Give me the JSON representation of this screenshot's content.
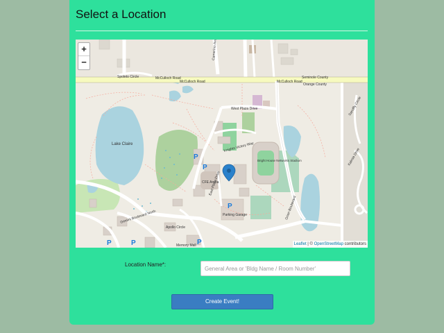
{
  "page": {
    "title": "Select a Location",
    "accent_color": "#2ee09c",
    "background_color": "#9dbba3"
  },
  "map": {
    "zoom_in_label": "+",
    "zoom_out_label": "−",
    "attribution": {
      "leaflet": "Leaflet",
      "separator": " | © ",
      "osm": "OpenStreetMap",
      "suffix": " contributors"
    },
    "labels": {
      "road_mcculloch_1": "McCulloch Road",
      "road_mcculloch_2": "McCulloch Road",
      "road_mcculloch_3": "McCulloch Road",
      "spoleto": "Spoleto Circle",
      "camerino": "Camerino Avenue",
      "seminole": "Seminole County",
      "orange": "Orange County",
      "west_plaza": "West Plaza Drive",
      "lake": "Lake Claire",
      "knights": "Knights Victory Way",
      "stadium": "Bright House Networks Stadium",
      "cfe": "CFE Arena",
      "east_plaza": "East Plaza Drive",
      "gemini": "Gemini Boulevard North",
      "orion": "Orion Boulevard",
      "parking": "Parking Garage",
      "apollo": "Apollo Circle",
      "memory": "Memory Mall",
      "kalmia": "Kalmia Drive",
      "sandy": "Sandfly Circle"
    },
    "parking_symbol": "P",
    "marker_icon": "map-pin-icon"
  },
  "form": {
    "location_label": "Location Name*:",
    "location_placeholder": "General Area or 'Bldg Name / Room Number'",
    "location_value": "",
    "submit_label": "Create Event!",
    "button_color": "#3a7dc2"
  }
}
